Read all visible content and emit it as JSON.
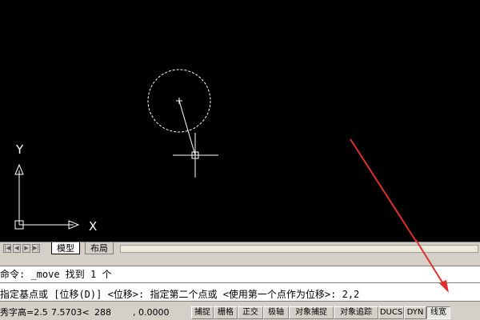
{
  "drawing": {
    "axis_labels": {
      "x": "X",
      "y": "Y"
    },
    "colors": {
      "background": "#000000",
      "geometry": "#ffffff",
      "annotation_arrow": "#e0302b"
    }
  },
  "tabs": [
    {
      "label": "模型",
      "active": true
    },
    {
      "label": "布局",
      "active": false
    }
  ],
  "command_history": [
    "命令: _move 找到 1 个",
    "指定基点或 [位移(D)] <位移>:  指定第二个点或 <使用第一个点作为位移>: 2,2"
  ],
  "status_bar": {
    "coord_prefix": "秀字高=2.5",
    "coord_x": "7.5703<",
    "coord_y": "288",
    "coord_z": ", 0.0000",
    "toggles": [
      {
        "label": "捕捉",
        "on": false
      },
      {
        "label": "栅格",
        "on": false
      },
      {
        "label": "正交",
        "on": false
      },
      {
        "label": "极轴",
        "on": false
      },
      {
        "label": "对象捕捉",
        "on": false
      },
      {
        "label": "对象追踪",
        "on": false
      },
      {
        "label": "DUCS",
        "on": false
      },
      {
        "label": "DYN",
        "on": false
      },
      {
        "label": "线宽",
        "on": true
      }
    ]
  }
}
